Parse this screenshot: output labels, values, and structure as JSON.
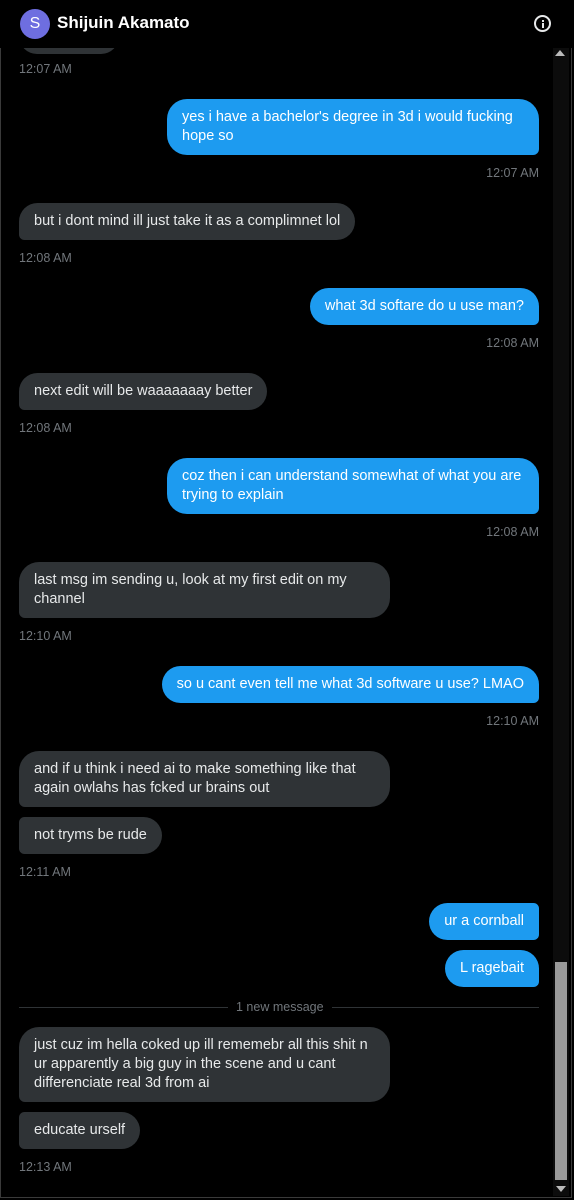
{
  "header": {
    "avatar_letter": "S",
    "contact_name": "Shijuin Akamato",
    "info_icon": "info-circle-icon"
  },
  "colors": {
    "background": "#000000",
    "incoming_bubble": "#2f3336",
    "outgoing_bubble": "#1d9bf0",
    "timestamp": "#71767b",
    "avatar": "#6e6ee0"
  },
  "messages": [
    {
      "direction": "in",
      "text": "",
      "time": "12:07 AM"
    },
    {
      "direction": "out",
      "text": "yes i have a bachelor's degree in 3d i would fucking hope so",
      "time": "12:07 AM"
    },
    {
      "direction": "in",
      "text": "but i dont mind ill just take it as a complimnet lol",
      "time": "12:08 AM"
    },
    {
      "direction": "out",
      "text": "what 3d softare do u use man?",
      "time": "12:08 AM"
    },
    {
      "direction": "in",
      "text": "next edit will be waaaaaaay better",
      "time": "12:08 AM"
    },
    {
      "direction": "out",
      "text": "coz then i can understand somewhat of what you are trying to explain",
      "time": "12:08 AM"
    },
    {
      "direction": "in",
      "text": "last msg im sending u, look at my first edit on my channel",
      "time": "12:10 AM"
    },
    {
      "direction": "out",
      "text": "so u cant even tell me what 3d software u use? LMAO",
      "time": "12:10 AM"
    },
    {
      "direction": "in",
      "text": "and if u think i need ai to make something like that again owlahs has fcked ur brains out",
      "time": ""
    },
    {
      "direction": "in",
      "text": "not tryms be rude",
      "time": "12:11 AM"
    },
    {
      "direction": "out",
      "text": "ur a cornball",
      "time": ""
    },
    {
      "direction": "out",
      "text": "L ragebait",
      "time": ""
    },
    {
      "direction": "in",
      "text": "just cuz im hella coked up ill rememebr all this shit n ur apparently a big guy in the scene and u cant differenciate real 3d from ai",
      "time": ""
    },
    {
      "direction": "in",
      "text": "educate urself",
      "time": "12:13 AM"
    }
  ],
  "divider_label": "1 new message"
}
